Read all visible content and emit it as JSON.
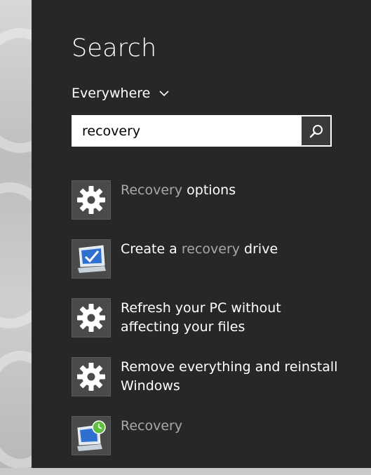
{
  "panel": {
    "title": "Search",
    "scope_label": "Everywhere"
  },
  "search": {
    "query": "recovery"
  },
  "results": [
    {
      "icon": "gear-icon",
      "parts": [
        {
          "text": "Recovery",
          "highlight": true
        },
        {
          "text": " options",
          "highlight": false
        }
      ]
    },
    {
      "icon": "monitor-check-icon",
      "parts": [
        {
          "text": "Create a ",
          "highlight": false
        },
        {
          "text": "recovery",
          "highlight": true
        },
        {
          "text": " drive",
          "highlight": false
        }
      ]
    },
    {
      "icon": "gear-icon",
      "parts": [
        {
          "text": "Refresh your PC without affecting your files",
          "highlight": false
        }
      ]
    },
    {
      "icon": "gear-icon",
      "parts": [
        {
          "text": "Remove everything and reinstall Windows",
          "highlight": false
        }
      ]
    },
    {
      "icon": "monitor-clock-icon",
      "parts": [
        {
          "text": "Recovery",
          "highlight": true
        }
      ]
    }
  ],
  "colors": {
    "panel_bg": "#272727",
    "highlight_text": "#a8a8a8",
    "tile_bg": "#4a4a4a"
  }
}
